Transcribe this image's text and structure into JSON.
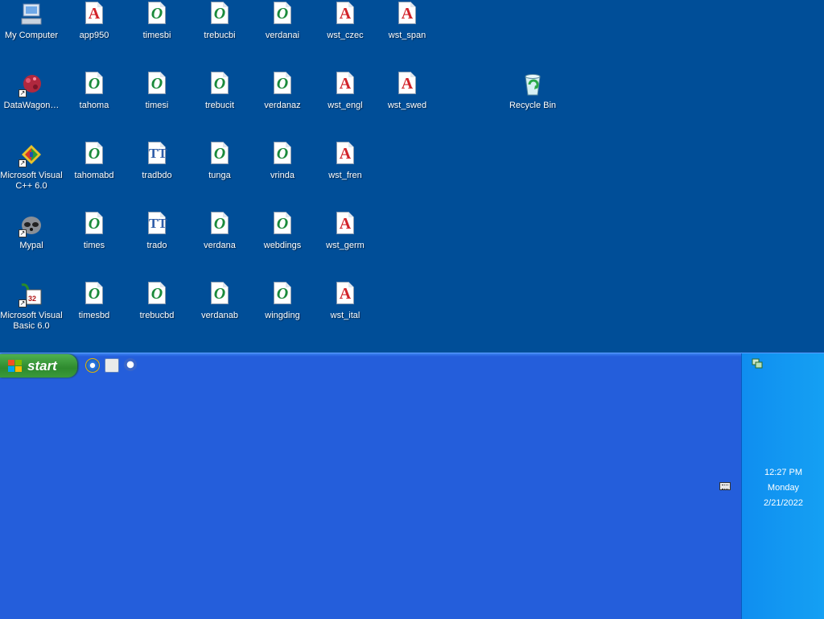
{
  "desktop": {
    "icons": [
      {
        "label": "My Computer",
        "icon": "my-computer-icon"
      },
      {
        "label": "app950",
        "icon": "font-a-icon"
      },
      {
        "label": "timesbi",
        "icon": "font-o-icon"
      },
      {
        "label": "trebucbi",
        "icon": "font-o-icon"
      },
      {
        "label": "verdanai",
        "icon": "font-o-icon"
      },
      {
        "label": "wst_czec",
        "icon": "font-a-icon"
      },
      {
        "label": "wst_span",
        "icon": "font-a-icon"
      },
      {
        "label": "DataWagon…",
        "icon": "datawagon-icon"
      },
      {
        "label": "tahoma",
        "icon": "font-o-icon"
      },
      {
        "label": "timesi",
        "icon": "font-o-icon"
      },
      {
        "label": "trebucit",
        "icon": "font-o-icon"
      },
      {
        "label": "verdanaz",
        "icon": "font-o-icon"
      },
      {
        "label": "wst_engl",
        "icon": "font-a-icon"
      },
      {
        "label": "wst_swed",
        "icon": "font-a-icon"
      },
      {
        "label": "Recycle Bin",
        "icon": "recycle-bin-icon"
      },
      {
        "label": "Microsoft Visual C++ 6.0",
        "icon": "visual-cpp-icon"
      },
      {
        "label": "tahomabd",
        "icon": "font-o-icon"
      },
      {
        "label": "tradbdo",
        "icon": "font-t-icon"
      },
      {
        "label": "tunga",
        "icon": "font-o-icon"
      },
      {
        "label": "vrinda",
        "icon": "font-o-icon"
      },
      {
        "label": "wst_fren",
        "icon": "font-a-icon"
      },
      {
        "label": "Mypal",
        "icon": "mypal-icon"
      },
      {
        "label": "times",
        "icon": "font-o-icon"
      },
      {
        "label": "trado",
        "icon": "font-t-icon"
      },
      {
        "label": "verdana",
        "icon": "font-o-icon"
      },
      {
        "label": "webdings",
        "icon": "font-o-icon"
      },
      {
        "label": "wst_germ",
        "icon": "font-a-icon"
      },
      {
        "label": "Microsoft Visual Basic 6.0",
        "icon": "visual-basic-icon"
      },
      {
        "label": "timesbd",
        "icon": "font-o-icon"
      },
      {
        "label": "trebucbd",
        "icon": "font-o-icon"
      },
      {
        "label": "verdanab",
        "icon": "font-o-icon"
      },
      {
        "label": "wingding",
        "icon": "font-o-icon"
      },
      {
        "label": "wst_ital",
        "icon": "font-a-icon"
      }
    ]
  },
  "taskbar": {
    "start_label": "start",
    "quick_launch": [
      "internet-explorer-icon",
      "show-desktop-icon",
      "media-player-icon"
    ],
    "clock": {
      "time": "12:27 PM",
      "day": "Monday",
      "date": "2/21/2022"
    }
  },
  "colors": {
    "desktop": "#004e98",
    "taskbar": "#245edb",
    "tray": "#0f8ef0",
    "start": "#3a9a3a"
  }
}
